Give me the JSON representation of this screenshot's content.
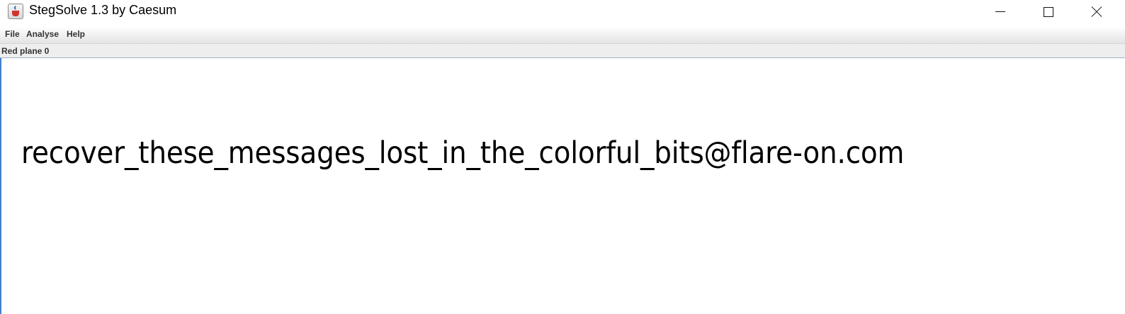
{
  "window": {
    "title": "StegSolve 1.3 by Caesum",
    "app_icon": "java-cup-icon",
    "controls": {
      "minimize_icon": "minimize-icon",
      "maximize_icon": "maximize-icon",
      "close_icon": "close-icon"
    }
  },
  "menubar": {
    "items": [
      {
        "label": "File"
      },
      {
        "label": "Analyse"
      },
      {
        "label": "Help"
      }
    ]
  },
  "status": {
    "plane_label": "Red plane 0"
  },
  "image": {
    "text": "recover_these_messages_lost_in_the_colorful_bits@flare-on.com"
  }
}
